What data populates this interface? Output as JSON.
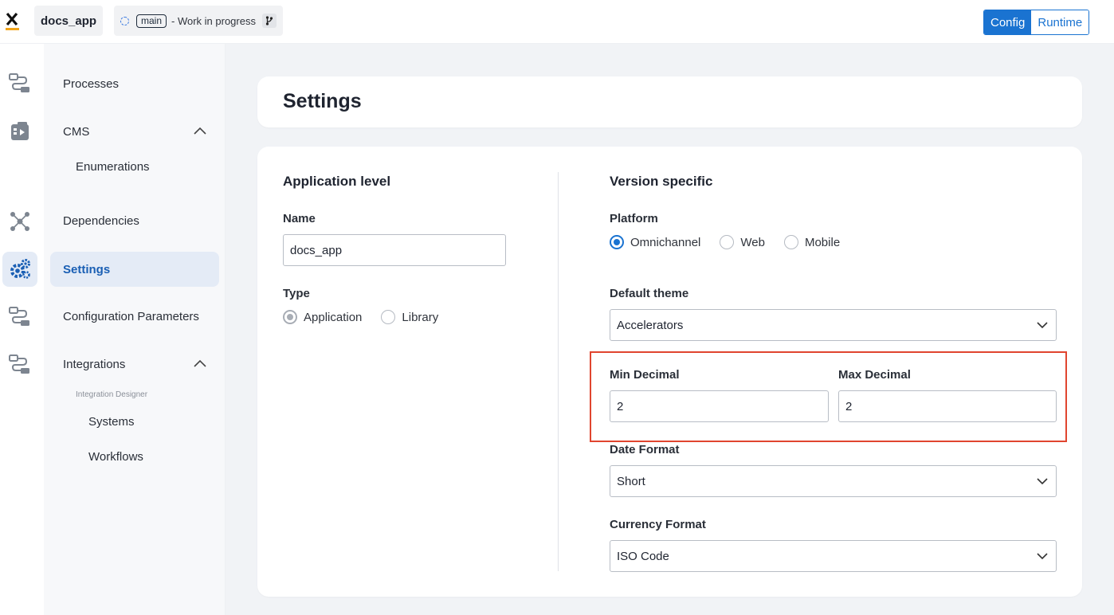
{
  "topbar": {
    "app_name": "docs_app",
    "branch_tag": "main",
    "branch_status": "- Work in progress",
    "mode_config": "Config",
    "mode_runtime": "Runtime"
  },
  "rail": {
    "icons": [
      "processes-icon",
      "cms-icon",
      "dependencies-icon",
      "settings-icon",
      "integrations-icon",
      "workflows-icon"
    ]
  },
  "sidenav": {
    "processes": "Processes",
    "cms": "CMS",
    "enumerations": "Enumerations",
    "dependencies": "Dependencies",
    "settings": "Settings",
    "config_params": "Configuration Parameters",
    "integrations": "Integrations",
    "integration_designer": "Integration Designer",
    "systems": "Systems",
    "workflows": "Workflows"
  },
  "page": {
    "title": "Settings"
  },
  "app_level": {
    "title": "Application level",
    "name_label": "Name",
    "name_value": "docs_app",
    "type_label": "Type",
    "type_options": [
      "Application",
      "Library"
    ],
    "type_selected": "Application"
  },
  "version_specific": {
    "title": "Version specific",
    "platform_label": "Platform",
    "platform_options": [
      "Omnichannel",
      "Web",
      "Mobile"
    ],
    "platform_selected": "Omnichannel",
    "theme_label": "Default theme",
    "theme_value": "Accelerators",
    "min_decimal_label": "Min Decimal",
    "min_decimal_value": "2",
    "max_decimal_label": "Max Decimal",
    "max_decimal_value": "2",
    "date_format_label": "Date Format",
    "date_format_value": "Short",
    "currency_format_label": "Currency Format",
    "currency_format_value": "ISO Code"
  },
  "colors": {
    "accent": "#1a73d1",
    "highlight": "#e0452f"
  }
}
